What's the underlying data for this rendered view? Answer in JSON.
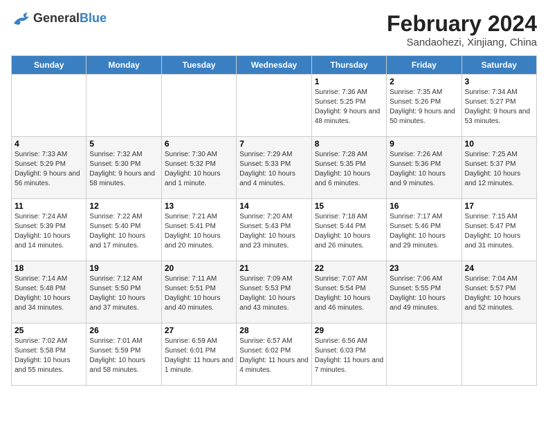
{
  "header": {
    "logo_text_general": "General",
    "logo_text_blue": "Blue",
    "month_year": "February 2024",
    "location": "Sandaohezi, Xinjiang, China"
  },
  "weekdays": [
    "Sunday",
    "Monday",
    "Tuesday",
    "Wednesday",
    "Thursday",
    "Friday",
    "Saturday"
  ],
  "weeks": [
    [
      {
        "day": "",
        "info": ""
      },
      {
        "day": "",
        "info": ""
      },
      {
        "day": "",
        "info": ""
      },
      {
        "day": "",
        "info": ""
      },
      {
        "day": "1",
        "info": "Sunrise: 7:36 AM\nSunset: 5:25 PM\nDaylight: 9 hours and 48 minutes."
      },
      {
        "day": "2",
        "info": "Sunrise: 7:35 AM\nSunset: 5:26 PM\nDaylight: 9 hours and 50 minutes."
      },
      {
        "day": "3",
        "info": "Sunrise: 7:34 AM\nSunset: 5:27 PM\nDaylight: 9 hours and 53 minutes."
      }
    ],
    [
      {
        "day": "4",
        "info": "Sunrise: 7:33 AM\nSunset: 5:29 PM\nDaylight: 9 hours and 56 minutes."
      },
      {
        "day": "5",
        "info": "Sunrise: 7:32 AM\nSunset: 5:30 PM\nDaylight: 9 hours and 58 minutes."
      },
      {
        "day": "6",
        "info": "Sunrise: 7:30 AM\nSunset: 5:32 PM\nDaylight: 10 hours and 1 minute."
      },
      {
        "day": "7",
        "info": "Sunrise: 7:29 AM\nSunset: 5:33 PM\nDaylight: 10 hours and 4 minutes."
      },
      {
        "day": "8",
        "info": "Sunrise: 7:28 AM\nSunset: 5:35 PM\nDaylight: 10 hours and 6 minutes."
      },
      {
        "day": "9",
        "info": "Sunrise: 7:26 AM\nSunset: 5:36 PM\nDaylight: 10 hours and 9 minutes."
      },
      {
        "day": "10",
        "info": "Sunrise: 7:25 AM\nSunset: 5:37 PM\nDaylight: 10 hours and 12 minutes."
      }
    ],
    [
      {
        "day": "11",
        "info": "Sunrise: 7:24 AM\nSunset: 5:39 PM\nDaylight: 10 hours and 14 minutes."
      },
      {
        "day": "12",
        "info": "Sunrise: 7:22 AM\nSunset: 5:40 PM\nDaylight: 10 hours and 17 minutes."
      },
      {
        "day": "13",
        "info": "Sunrise: 7:21 AM\nSunset: 5:41 PM\nDaylight: 10 hours and 20 minutes."
      },
      {
        "day": "14",
        "info": "Sunrise: 7:20 AM\nSunset: 5:43 PM\nDaylight: 10 hours and 23 minutes."
      },
      {
        "day": "15",
        "info": "Sunrise: 7:18 AM\nSunset: 5:44 PM\nDaylight: 10 hours and 26 minutes."
      },
      {
        "day": "16",
        "info": "Sunrise: 7:17 AM\nSunset: 5:46 PM\nDaylight: 10 hours and 29 minutes."
      },
      {
        "day": "17",
        "info": "Sunrise: 7:15 AM\nSunset: 5:47 PM\nDaylight: 10 hours and 31 minutes."
      }
    ],
    [
      {
        "day": "18",
        "info": "Sunrise: 7:14 AM\nSunset: 5:48 PM\nDaylight: 10 hours and 34 minutes."
      },
      {
        "day": "19",
        "info": "Sunrise: 7:12 AM\nSunset: 5:50 PM\nDaylight: 10 hours and 37 minutes."
      },
      {
        "day": "20",
        "info": "Sunrise: 7:11 AM\nSunset: 5:51 PM\nDaylight: 10 hours and 40 minutes."
      },
      {
        "day": "21",
        "info": "Sunrise: 7:09 AM\nSunset: 5:53 PM\nDaylight: 10 hours and 43 minutes."
      },
      {
        "day": "22",
        "info": "Sunrise: 7:07 AM\nSunset: 5:54 PM\nDaylight: 10 hours and 46 minutes."
      },
      {
        "day": "23",
        "info": "Sunrise: 7:06 AM\nSunset: 5:55 PM\nDaylight: 10 hours and 49 minutes."
      },
      {
        "day": "24",
        "info": "Sunrise: 7:04 AM\nSunset: 5:57 PM\nDaylight: 10 hours and 52 minutes."
      }
    ],
    [
      {
        "day": "25",
        "info": "Sunrise: 7:02 AM\nSunset: 5:58 PM\nDaylight: 10 hours and 55 minutes."
      },
      {
        "day": "26",
        "info": "Sunrise: 7:01 AM\nSunset: 5:59 PM\nDaylight: 10 hours and 58 minutes."
      },
      {
        "day": "27",
        "info": "Sunrise: 6:59 AM\nSunset: 6:01 PM\nDaylight: 11 hours and 1 minute."
      },
      {
        "day": "28",
        "info": "Sunrise: 6:57 AM\nSunset: 6:02 PM\nDaylight: 11 hours and 4 minutes."
      },
      {
        "day": "29",
        "info": "Sunrise: 6:56 AM\nSunset: 6:03 PM\nDaylight: 11 hours and 7 minutes."
      },
      {
        "day": "",
        "info": ""
      },
      {
        "day": "",
        "info": ""
      }
    ]
  ]
}
